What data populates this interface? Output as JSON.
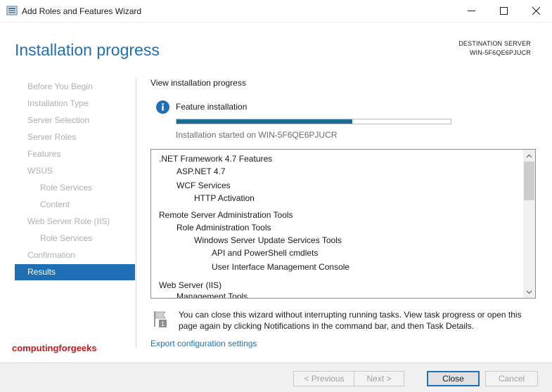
{
  "window": {
    "title": "Add Roles and Features Wizard"
  },
  "header": {
    "page_title": "Installation progress",
    "destination_label": "DESTINATION SERVER",
    "destination_server": "WIN-5F6QE6PJUCR"
  },
  "nav": {
    "items": [
      {
        "label": "Before You Begin",
        "level": 0,
        "active": false
      },
      {
        "label": "Installation Type",
        "level": 0,
        "active": false
      },
      {
        "label": "Server Selection",
        "level": 0,
        "active": false
      },
      {
        "label": "Server Roles",
        "level": 0,
        "active": false
      },
      {
        "label": "Features",
        "level": 0,
        "active": false
      },
      {
        "label": "WSUS",
        "level": 0,
        "active": false
      },
      {
        "label": "Role Services",
        "level": 1,
        "active": false
      },
      {
        "label": "Content",
        "level": 1,
        "active": false
      },
      {
        "label": "Web Server Role (IIS)",
        "level": 0,
        "active": false
      },
      {
        "label": "Role Services",
        "level": 1,
        "active": false
      },
      {
        "label": "Confirmation",
        "level": 0,
        "active": false
      },
      {
        "label": "Results",
        "level": 0,
        "active": true
      }
    ]
  },
  "main": {
    "section_label": "View installation progress",
    "feature_label": "Feature installation",
    "progress_fraction": 0.64,
    "started_label": "Installation started on WIN-5F6QE6PJUCR",
    "features": [
      {
        "label": ".NET Framework 4.7 Features",
        "level": 0
      },
      {
        "label": "ASP.NET 4.7",
        "level": 1
      },
      {
        "label": "WCF Services",
        "level": 1
      },
      {
        "label": "HTTP Activation",
        "level": 2
      },
      {
        "label": "Remote Server Administration Tools",
        "level": 0
      },
      {
        "label": "Role Administration Tools",
        "level": 1
      },
      {
        "label": "Windows Server Update Services Tools",
        "level": 2
      },
      {
        "label": "API and PowerShell cmdlets",
        "level": 3
      },
      {
        "label": "User Interface Management Console",
        "level": 3
      },
      {
        "label": "Web Server (IIS)",
        "level": 0
      },
      {
        "label": "Management Tools",
        "level": 1
      }
    ],
    "notice": "You can close this wizard without interrupting running tasks. View task progress or open this page again by clicking Notifications in the command bar, and then Task Details.",
    "export_link": "Export configuration settings"
  },
  "watermark": "computingforgeeks",
  "footer": {
    "previous_label": "< Previous",
    "next_label": "Next >",
    "close_label": "Close",
    "cancel_label": "Cancel"
  },
  "colors": {
    "accent": "#1e6fb3",
    "progress": "#1b6c98",
    "watermark": "#d0151a"
  }
}
